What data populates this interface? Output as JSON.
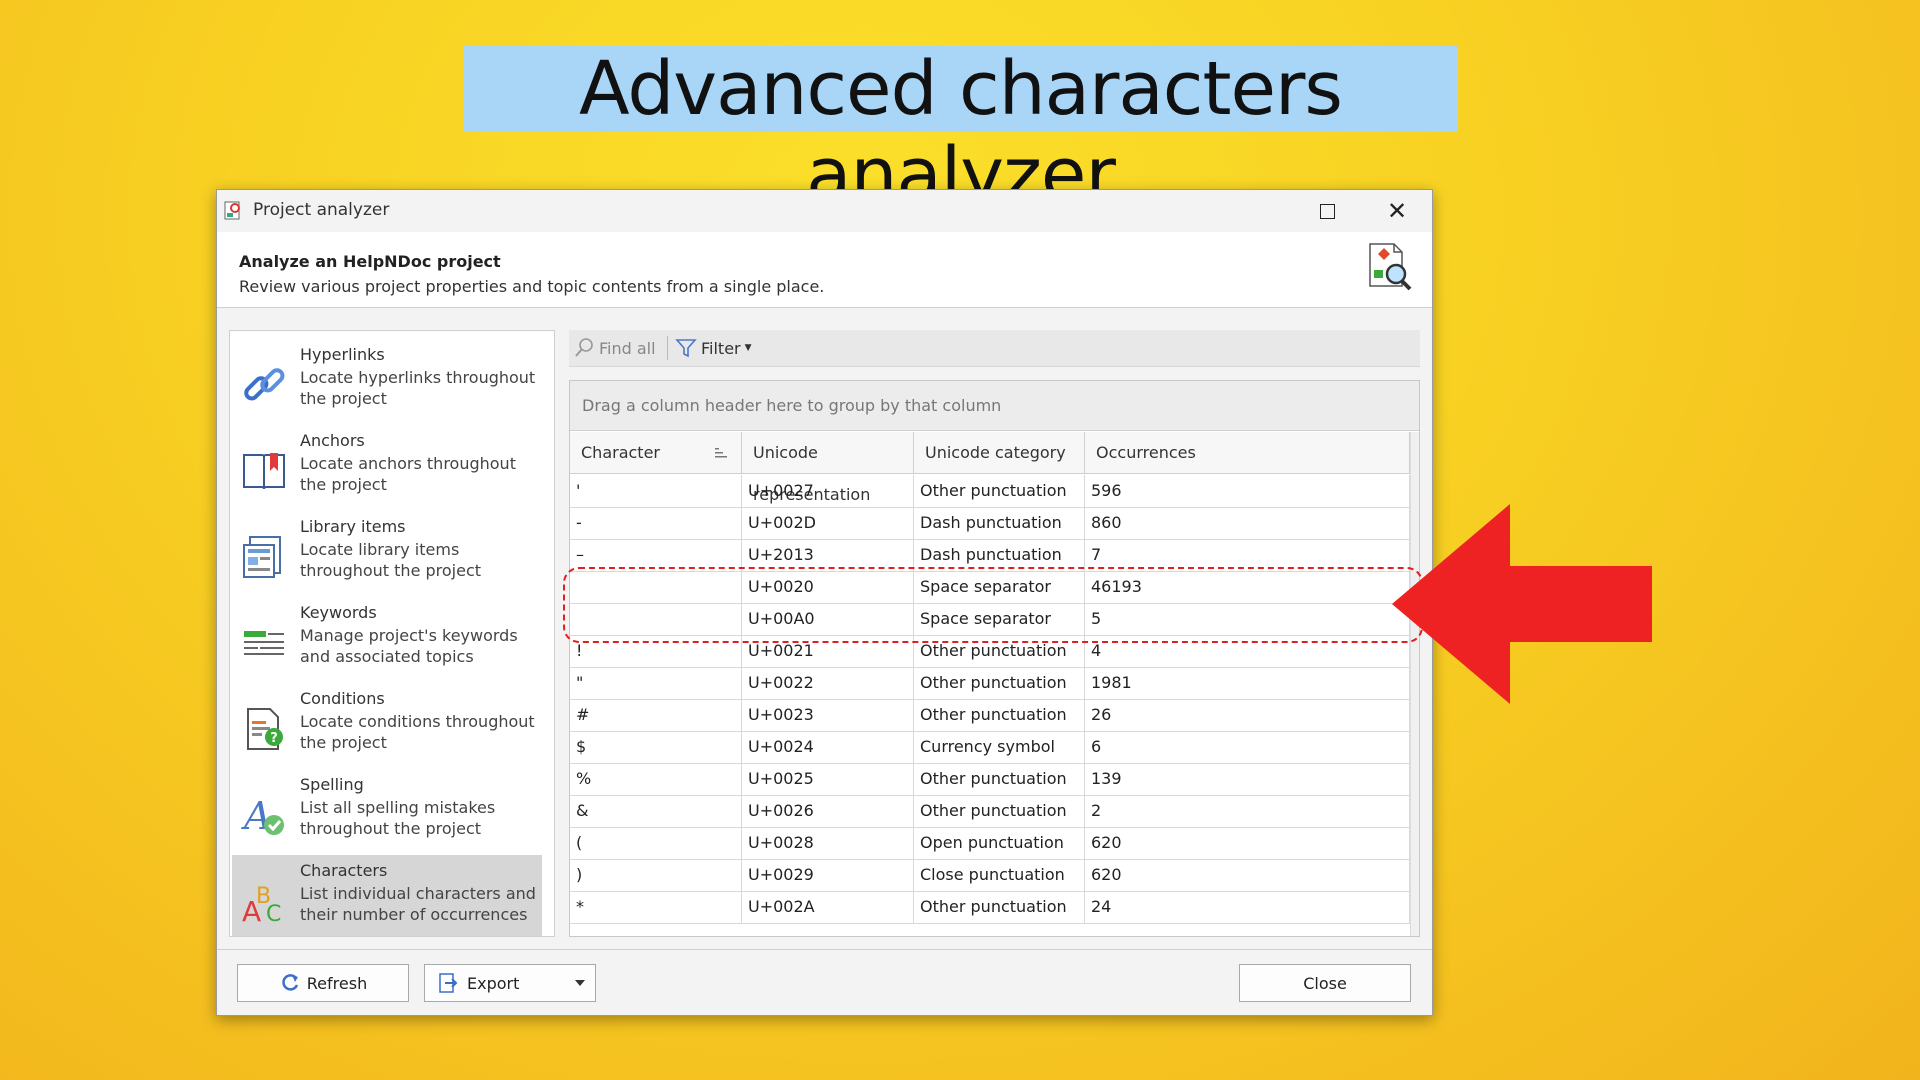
{
  "slide": {
    "title": "Advanced characters analyzer"
  },
  "window": {
    "title": "Project analyzer",
    "maximize_icon": "maximize-icon",
    "close_icon": "close-icon"
  },
  "header": {
    "title": "Analyze an HelpNDoc project",
    "description": "Review various project properties and topic contents from a single place."
  },
  "sidebar": {
    "items": [
      {
        "label": "Hyperlinks",
        "description": "Locate hyperlinks throughout the project",
        "icon": "link-icon"
      },
      {
        "label": "Anchors",
        "description": "Locate anchors throughout the project",
        "icon": "bookmark-icon"
      },
      {
        "label": "Library items",
        "description": "Locate library items throughout the project",
        "icon": "library-icon"
      },
      {
        "label": "Keywords",
        "description": "Manage project's keywords and associated topics",
        "icon": "keywords-icon"
      },
      {
        "label": "Conditions",
        "description": "Locate conditions throughout the project",
        "icon": "conditions-icon"
      },
      {
        "label": "Spelling",
        "description": "List all spelling mistakes throughout the project",
        "icon": "spelling-icon"
      },
      {
        "label": "Characters",
        "description": "List individual characters and their number of occurrences",
        "icon": "characters-icon"
      }
    ],
    "selected_index": 6
  },
  "toolbar": {
    "find_all": "Find all",
    "filter": "Filter"
  },
  "grid": {
    "group_hint": "Drag a column header here to group by that column",
    "columns": [
      "Character",
      "Unicode representation",
      "Unicode category",
      "Occurrences"
    ],
    "rows": [
      [
        "'",
        "U+0027",
        "Other punctuation",
        "596"
      ],
      [
        "-",
        "U+002D",
        "Dash punctuation",
        "860"
      ],
      [
        "–",
        "U+2013",
        "Dash punctuation",
        "7"
      ],
      [
        "",
        "U+0020",
        "Space separator",
        "46193"
      ],
      [
        "",
        "U+00A0",
        "Space separator",
        "5"
      ],
      [
        "!",
        "U+0021",
        "Other punctuation",
        "4"
      ],
      [
        "\"",
        "U+0022",
        "Other punctuation",
        "1981"
      ],
      [
        "#",
        "U+0023",
        "Other punctuation",
        "26"
      ],
      [
        "$",
        "U+0024",
        "Currency symbol",
        "6"
      ],
      [
        "%",
        "U+0025",
        "Other punctuation",
        "139"
      ],
      [
        "&",
        "U+0026",
        "Other punctuation",
        "2"
      ],
      [
        "(",
        "U+0028",
        "Open punctuation",
        "620"
      ],
      [
        ")",
        "U+0029",
        "Close punctuation",
        "620"
      ],
      [
        "*",
        "U+002A",
        "Other punctuation",
        "24"
      ]
    ]
  },
  "footer": {
    "refresh": "Refresh",
    "export": "Export",
    "close": "Close"
  },
  "colors": {
    "highlight": "#e02020",
    "arrow": "#ee2222",
    "title_bg": "#a9d6f6"
  }
}
